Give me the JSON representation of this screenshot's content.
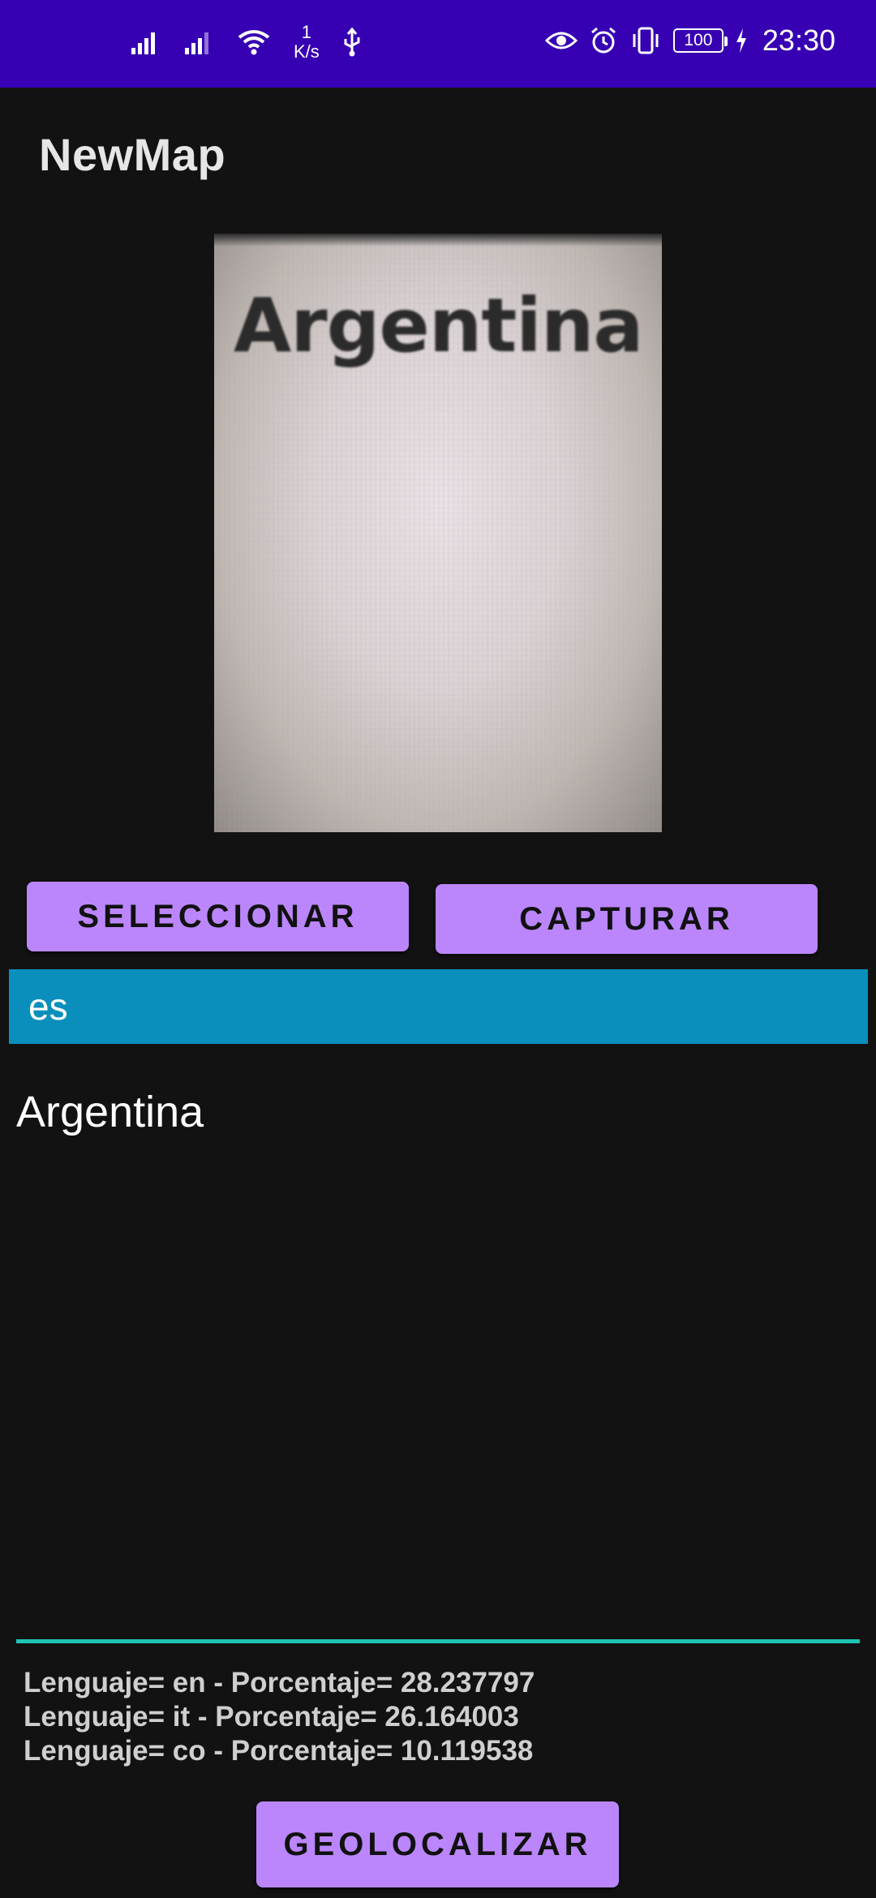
{
  "status_bar": {
    "network_speed_value": "1",
    "network_speed_unit": "K/s",
    "battery": "100",
    "time": "23:30",
    "icons": [
      "signal-icon",
      "signal-icon",
      "wifi-icon",
      "usb-icon",
      "eye-icon",
      "alarm-icon",
      "vibrate-icon",
      "battery-icon",
      "charging-icon"
    ]
  },
  "app": {
    "title": "NewMap"
  },
  "image": {
    "text": "Argentina"
  },
  "buttons": {
    "select_label": "SELECCIONAR",
    "capture_label": "CAPTURAR",
    "geolocate_label": "GEOLOCALIZAR"
  },
  "language_field": {
    "value": "es"
  },
  "recognized_text": "Argentina",
  "results": [
    "Lenguaje= en - Porcentaje= 28.237797",
    "Lenguaje= it - Porcentaje= 26.164003",
    "Lenguaje= co - Porcentaje= 10.119538"
  ],
  "colors": {
    "status_bar": "#3700b3",
    "background": "#121212",
    "button": "#bb86fc",
    "language_bar": "#0a8fbd",
    "divider": "#1fc4b4"
  }
}
